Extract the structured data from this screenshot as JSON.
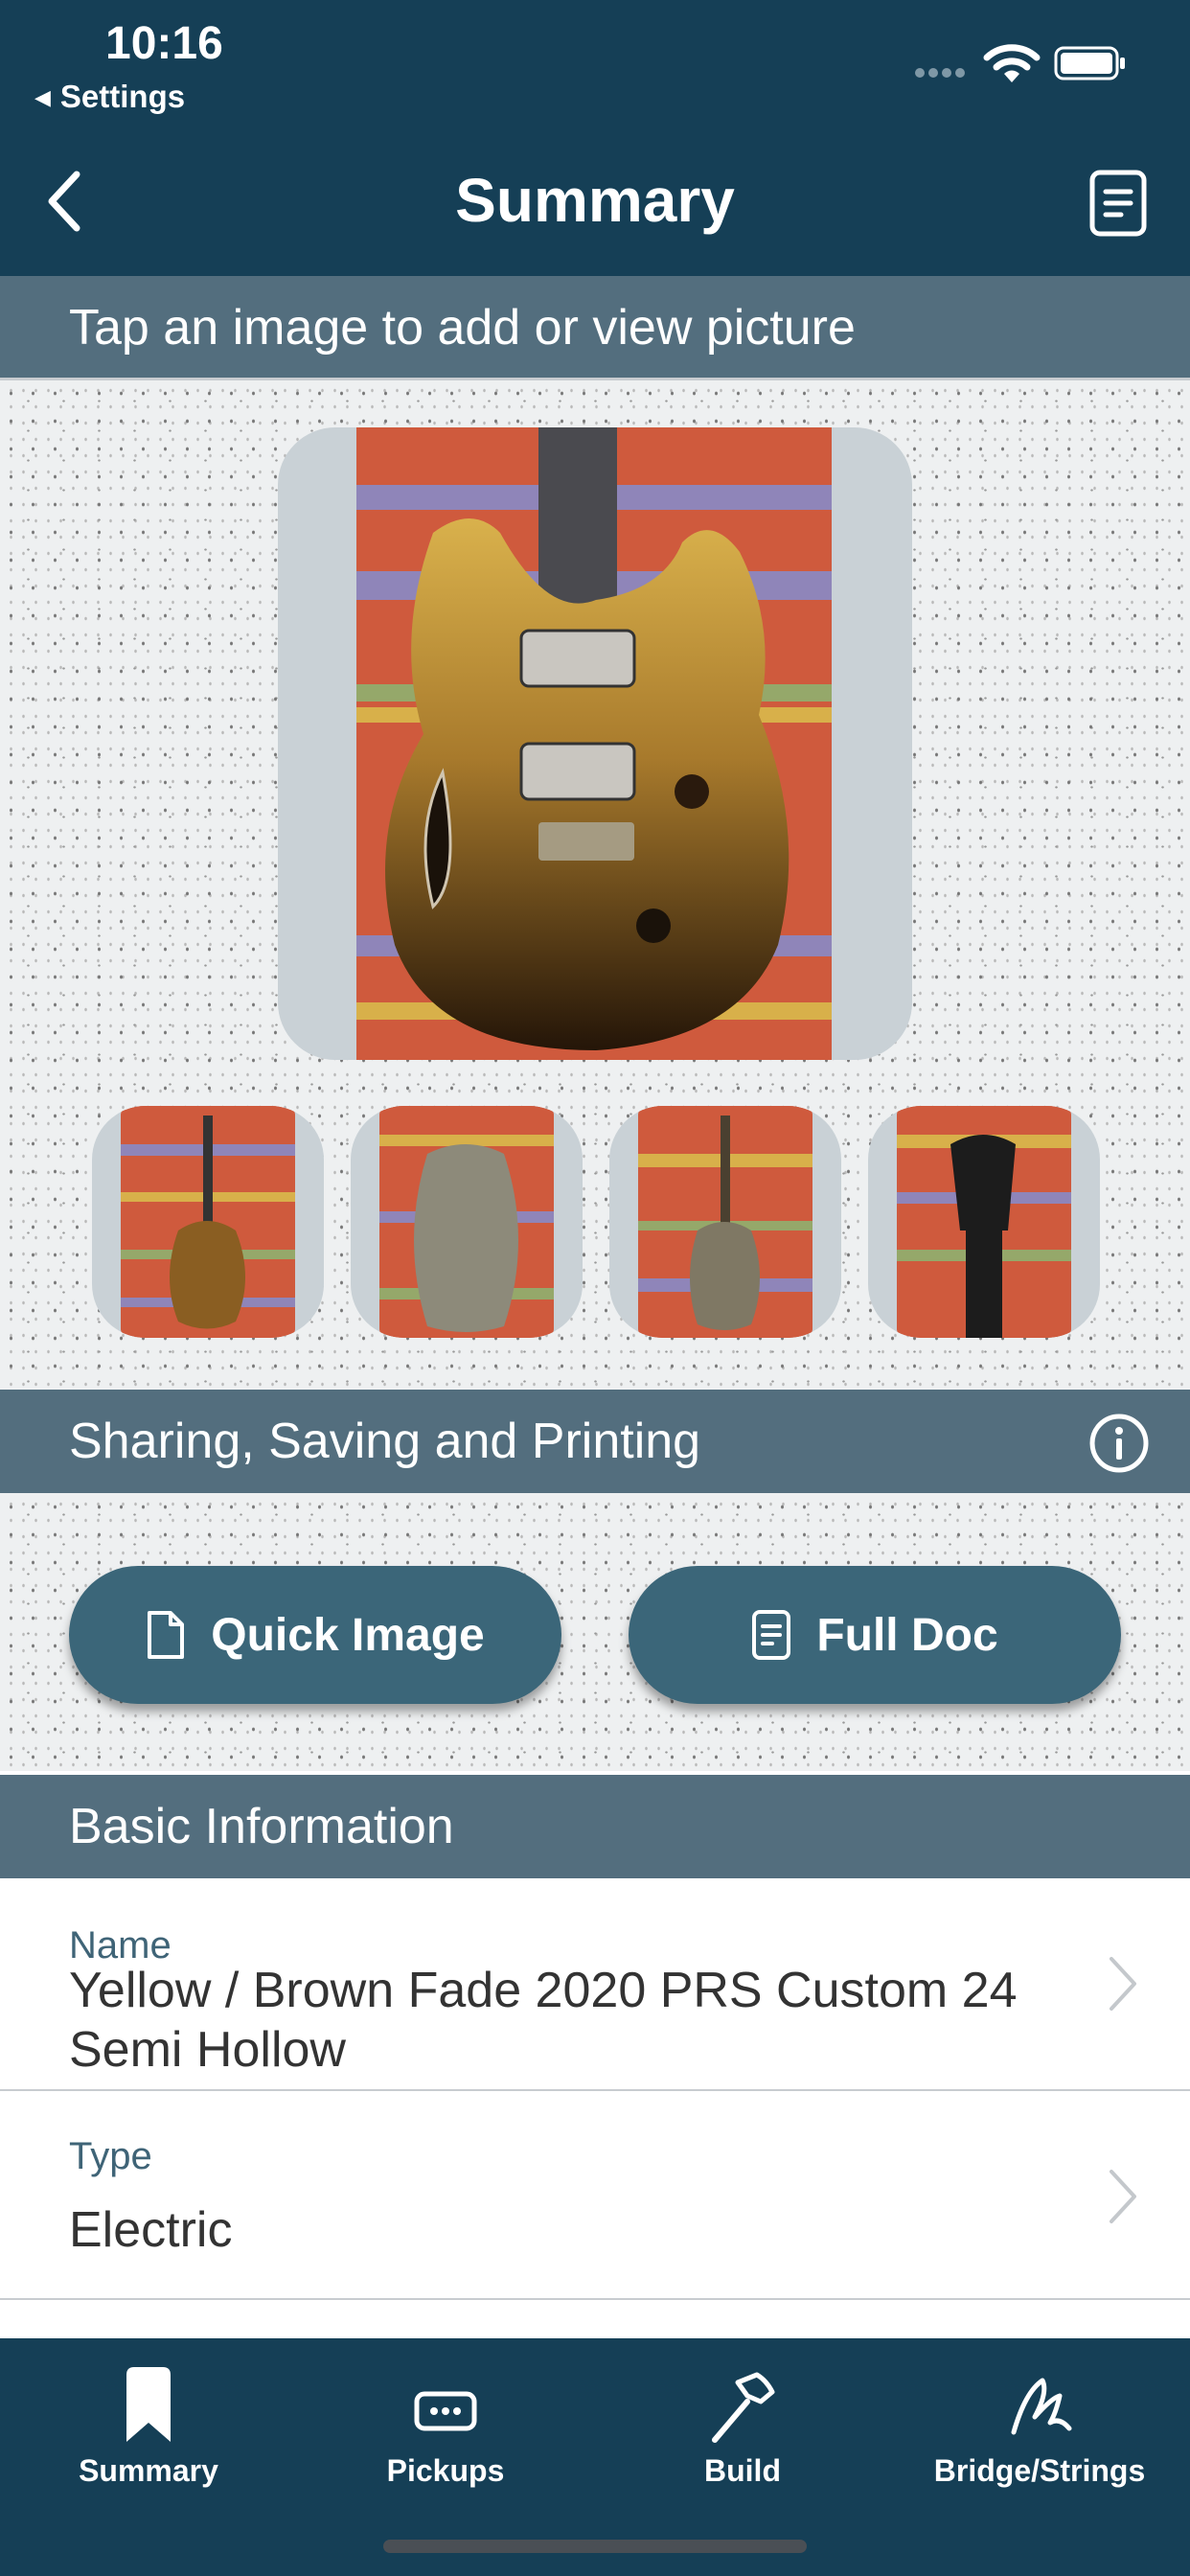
{
  "status_bar": {
    "time": "10:16",
    "back_app": "Settings"
  },
  "nav": {
    "title": "Summary"
  },
  "photos": {
    "section_title": "Tap an image to add or view picture",
    "thumbnail_count": 4
  },
  "sharing": {
    "section_title": "Sharing, Saving and Printing",
    "quick_image_label": "Quick Image",
    "full_doc_label": "Full Doc"
  },
  "basic_info": {
    "section_title": "Basic Information",
    "rows": [
      {
        "label": "Name",
        "value": "Yellow / Brown Fade 2020 PRS Custom 24 Semi Hollow"
      },
      {
        "label": "Type",
        "value": "Electric"
      }
    ]
  },
  "tabs": [
    {
      "label": "Summary",
      "icon": "bookmark-icon",
      "selected": true
    },
    {
      "label": "Pickups",
      "icon": "pickup-icon"
    },
    {
      "label": "Build",
      "icon": "hammer-icon"
    },
    {
      "label": "Bridge/Strings",
      "icon": "signature-icon"
    }
  ],
  "colors": {
    "header": "#153f56",
    "section_header": "#536e7e",
    "button": "#3b6679",
    "label": "#3f6477"
  }
}
